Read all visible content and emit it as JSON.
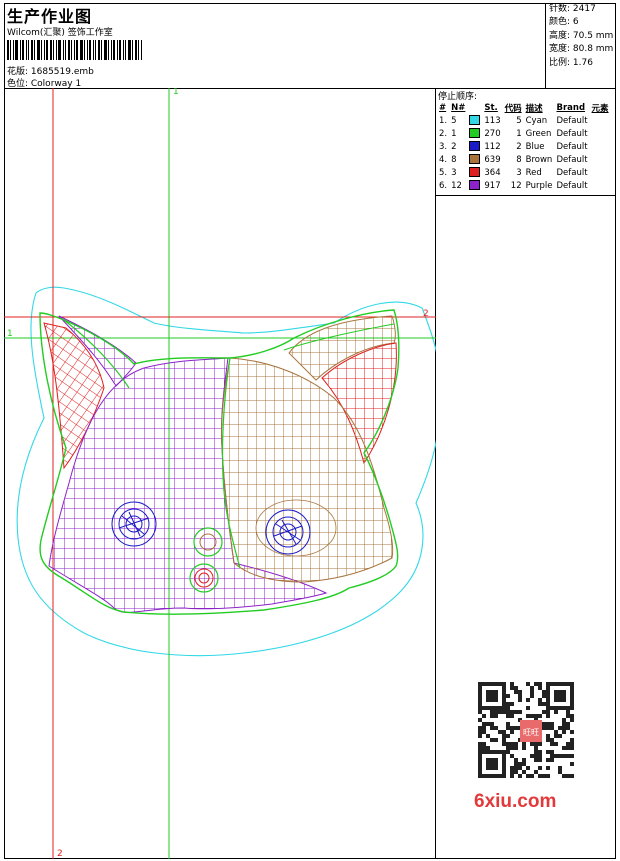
{
  "header": {
    "title": "生产作业图",
    "company": "Wilcom(汇聚) 签饰工作室",
    "design_label": "花版: 1685519.emb",
    "colorway_label": "色位: Colorway 1"
  },
  "stats": [
    {
      "label": "针数: 2417"
    },
    {
      "label": "颜色: 6"
    },
    {
      "label": "高度: 70.5 mm"
    },
    {
      "label": "宽度: 80.8 mm"
    },
    {
      "label": "比例: 1.76"
    }
  ],
  "markers": {
    "v1": "1",
    "v2": "2",
    "h1": "1",
    "h2": "2"
  },
  "stop_sequence": {
    "title": "停止顺序:",
    "headers": [
      "#",
      "N#",
      "St.",
      "代码",
      "描述",
      "Brand",
      "元素"
    ],
    "rows": [
      {
        "idx": "1.",
        "n": "5",
        "color": "#32d8e6",
        "st": "113",
        "code": "5",
        "desc": "Cyan",
        "brand": "Default"
      },
      {
        "idx": "2.",
        "n": "1",
        "color": "#22cc22",
        "st": "270",
        "code": "1",
        "desc": "Green",
        "brand": "Default"
      },
      {
        "idx": "3.",
        "n": "2",
        "color": "#1a1ac8",
        "st": "112",
        "code": "2",
        "desc": "Blue",
        "brand": "Default"
      },
      {
        "idx": "4.",
        "n": "8",
        "color": "#a8743c",
        "st": "639",
        "code": "8",
        "desc": "Brown",
        "brand": "Default"
      },
      {
        "idx": "5.",
        "n": "3",
        "color": "#e02020",
        "st": "364",
        "code": "3",
        "desc": "Red",
        "brand": "Default"
      },
      {
        "idx": "6.",
        "n": "12",
        "color": "#8c22c8",
        "st": "917",
        "code": "12",
        "desc": "Purple",
        "brand": "Default"
      }
    ]
  },
  "watermark": {
    "logo_text": "6xiu.com",
    "qr_badge": "旺旺"
  }
}
